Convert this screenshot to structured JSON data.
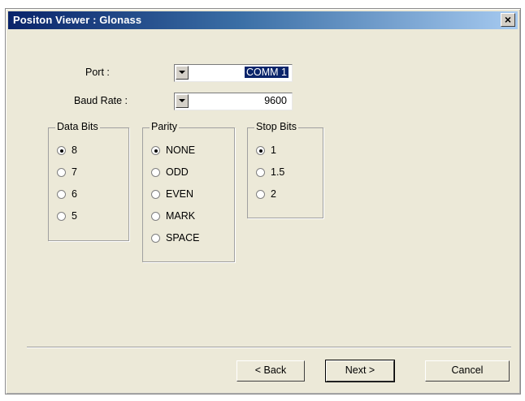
{
  "window": {
    "title": "Positon Viewer : Glonass",
    "close_glyph": "×",
    "title_gradient": [
      "#0a246a",
      "#a6caf0"
    ]
  },
  "form": {
    "port_label": "Port :",
    "port_value": "COMM 1",
    "baud_label": "Baud Rate :",
    "baud_value": "9600"
  },
  "data_bits": {
    "title": "Data Bits",
    "options": [
      {
        "label": "8",
        "selected": true
      },
      {
        "label": "7",
        "selected": false
      },
      {
        "label": "6",
        "selected": false
      },
      {
        "label": "5",
        "selected": false
      }
    ]
  },
  "parity": {
    "title": "Parity",
    "options": [
      {
        "label": "NONE",
        "selected": true
      },
      {
        "label": "ODD",
        "selected": false
      },
      {
        "label": "EVEN",
        "selected": false
      },
      {
        "label": "MARK",
        "selected": false
      },
      {
        "label": "SPACE",
        "selected": false
      }
    ]
  },
  "stop_bits": {
    "title": "Stop Bits",
    "options": [
      {
        "label": "1",
        "selected": true
      },
      {
        "label": "1.5",
        "selected": false
      },
      {
        "label": "2",
        "selected": false
      }
    ]
  },
  "buttons": {
    "back": "< Back",
    "next": "Next >",
    "cancel": "Cancel"
  }
}
